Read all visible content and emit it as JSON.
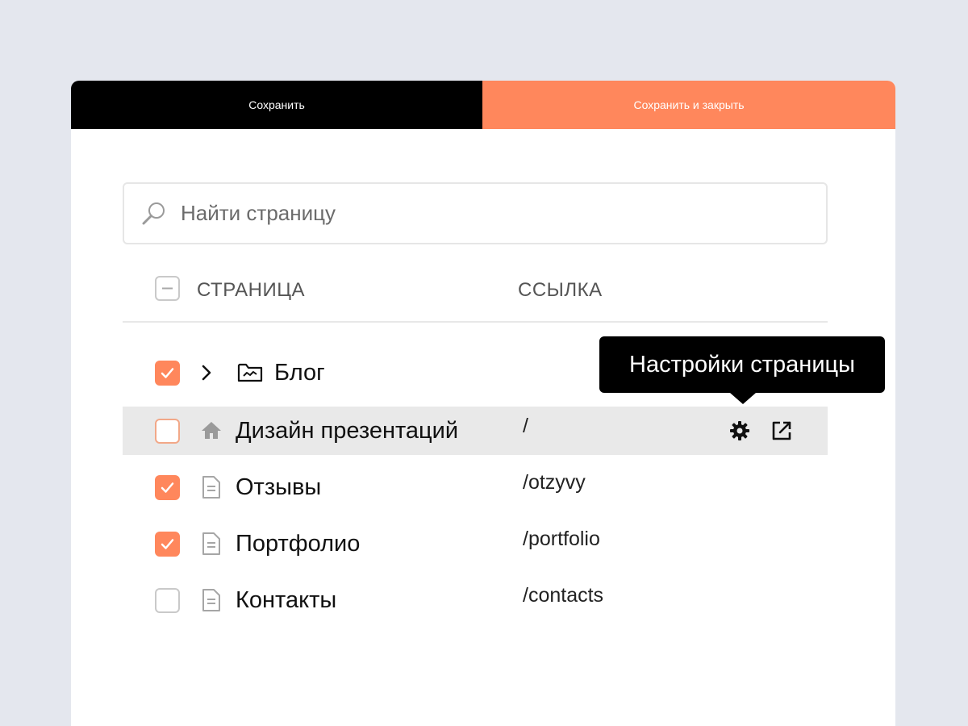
{
  "toolbar": {
    "save_label": "Сохранить",
    "save_close_label": "Сохранить и закрыть"
  },
  "search": {
    "placeholder": "Найти страницу",
    "value": ""
  },
  "table": {
    "columns": {
      "page": "СТРАНИЦА",
      "link": "ССЫЛКА"
    },
    "rows": [
      {
        "name": "Блог",
        "link": "",
        "checked": true,
        "type": "folder"
      },
      {
        "name": "Дизайн презентаций",
        "link": "/",
        "checked": false,
        "type": "home"
      },
      {
        "name": "Отзывы",
        "link": "/otzyvy",
        "checked": true,
        "type": "page"
      },
      {
        "name": "Портфолио",
        "link": "/portfolio",
        "checked": true,
        "type": "page"
      },
      {
        "name": "Контакты",
        "link": "/contacts",
        "checked": false,
        "type": "page"
      }
    ]
  },
  "tooltip": {
    "text": "Настройки страницы"
  },
  "colors": {
    "accent": "#ff875c",
    "dark": "#000000",
    "background": "#e4e7ee"
  },
  "icons": [
    "search-icon",
    "chevron-right-icon",
    "folder-icon",
    "home-icon",
    "page-icon",
    "gear-icon",
    "external-link-icon",
    "minus-icon",
    "checkmark-icon"
  ]
}
